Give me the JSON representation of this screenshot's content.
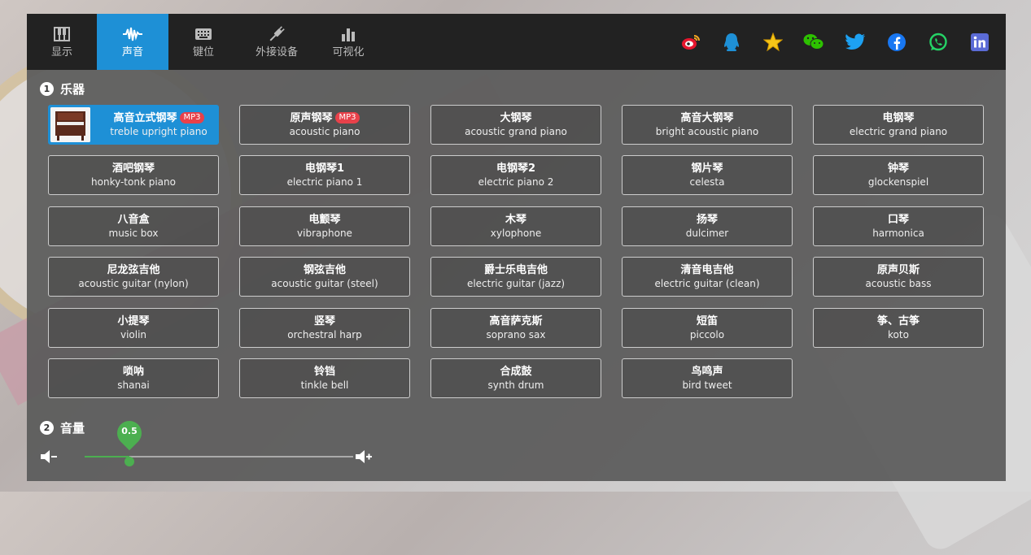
{
  "tabs": [
    {
      "label": "显示",
      "icon": "piano-keys-icon",
      "active": false
    },
    {
      "label": "声音",
      "icon": "waveform-icon",
      "active": true
    },
    {
      "label": "键位",
      "icon": "keyboard-icon",
      "active": false
    },
    {
      "label": "外接设备",
      "icon": "plug-icon",
      "active": false
    },
    {
      "label": "可视化",
      "icon": "bar-chart-icon",
      "active": false
    }
  ],
  "social": [
    {
      "name": "weibo-icon",
      "color": "#e6162d"
    },
    {
      "name": "qq-icon",
      "color": "#1e90d6"
    },
    {
      "name": "qzone-star-icon",
      "color": "#f5c518"
    },
    {
      "name": "wechat-icon",
      "color": "#2dc100"
    },
    {
      "name": "twitter-icon",
      "color": "#1da1f2"
    },
    {
      "name": "facebook-icon",
      "color": "#1877f2"
    },
    {
      "name": "whatsapp-icon",
      "color": "#25d366"
    },
    {
      "name": "linkedin-icon",
      "color": "#5b6bd6"
    }
  ],
  "instruments_section": {
    "number": "1",
    "title": "乐器"
  },
  "instruments": [
    {
      "cn": "高音立式钢琴",
      "en": "treble upright piano",
      "badge": "MP3",
      "selected": true
    },
    {
      "cn": "原声钢琴",
      "en": "acoustic piano",
      "badge": "MP3"
    },
    {
      "cn": "大钢琴",
      "en": "acoustic grand piano"
    },
    {
      "cn": "高音大钢琴",
      "en": "bright acoustic piano"
    },
    {
      "cn": "电钢琴",
      "en": "electric grand piano"
    },
    {
      "cn": "酒吧钢琴",
      "en": "honky-tonk piano"
    },
    {
      "cn": "电钢琴1",
      "en": "electric piano 1"
    },
    {
      "cn": "电钢琴2",
      "en": "electric piano 2"
    },
    {
      "cn": "钢片琴",
      "en": "celesta"
    },
    {
      "cn": "钟琴",
      "en": "glockenspiel"
    },
    {
      "cn": "八音盒",
      "en": "music box"
    },
    {
      "cn": "电颤琴",
      "en": "vibraphone"
    },
    {
      "cn": "木琴",
      "en": "xylophone"
    },
    {
      "cn": "扬琴",
      "en": "dulcimer"
    },
    {
      "cn": "口琴",
      "en": "harmonica"
    },
    {
      "cn": "尼龙弦吉他",
      "en": "acoustic guitar (nylon)"
    },
    {
      "cn": "钢弦吉他",
      "en": "acoustic guitar (steel)"
    },
    {
      "cn": "爵士乐电吉他",
      "en": "electric guitar (jazz)"
    },
    {
      "cn": "清音电吉他",
      "en": "electric guitar (clean)"
    },
    {
      "cn": "原声贝斯",
      "en": "acoustic bass"
    },
    {
      "cn": "小提琴",
      "en": "violin"
    },
    {
      "cn": "竖琴",
      "en": "orchestral harp"
    },
    {
      "cn": "高音萨克斯",
      "en": "soprano sax"
    },
    {
      "cn": "短笛",
      "en": "piccolo"
    },
    {
      "cn": "筝、古筝",
      "en": "koto"
    },
    {
      "cn": "唢呐",
      "en": "shanai"
    },
    {
      "cn": "铃铛",
      "en": "tinkle bell"
    },
    {
      "cn": "合成鼓",
      "en": "synth drum"
    },
    {
      "cn": "鸟鸣声",
      "en": "bird tweet"
    }
  ],
  "volume_section": {
    "number": "2",
    "title": "音量"
  },
  "volume": {
    "value": 0.5,
    "label": "0.5",
    "accent": "#4caf50"
  }
}
